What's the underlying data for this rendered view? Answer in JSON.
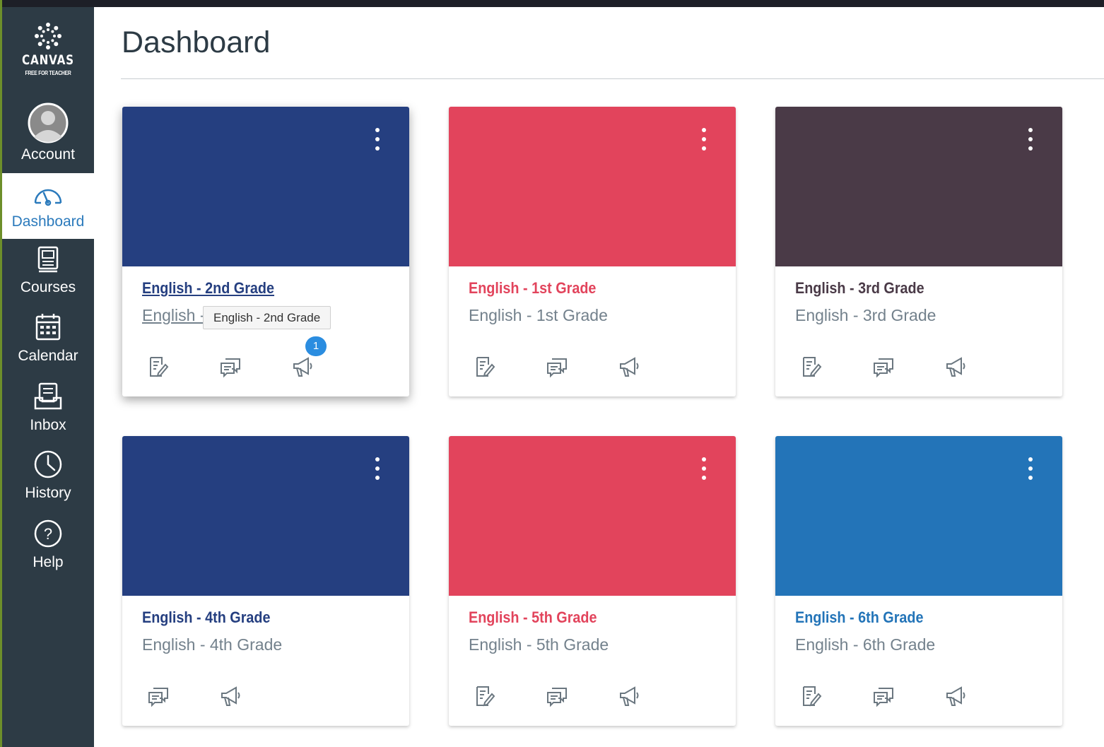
{
  "logo": {
    "brand": "CANVAS",
    "tagline": "FREE FOR TEACHER"
  },
  "nav": {
    "account": "Account",
    "dashboard": "Dashboard",
    "courses": "Courses",
    "calendar": "Calendar",
    "inbox": "Inbox",
    "history": "History",
    "help": "Help"
  },
  "page": {
    "title": "Dashboard"
  },
  "colors": {
    "sidebar": "#2d3b45",
    "active_nav_text": "#2b7abc",
    "navy": "#253f80",
    "red": "#e2445c",
    "plum": "#4a3a47",
    "blue": "#2374b8",
    "badge": "#2b8de0"
  },
  "cards": [
    {
      "name": "English - 2nd Grade",
      "subtitle": "English - 2nd Grade",
      "color": "#253f80",
      "tooltip": "English - 2nd Grade",
      "badge": "1",
      "actions": [
        "assignments-icon",
        "discussions-icon",
        "announcements-icon"
      ]
    },
    {
      "name": "English - 1st Grade",
      "subtitle": "English - 1st Grade",
      "color": "#e2445c",
      "actions": [
        "assignments-icon",
        "discussions-icon",
        "announcements-icon"
      ]
    },
    {
      "name": "English - 3rd Grade",
      "subtitle": "English - 3rd Grade",
      "color": "#4a3a47",
      "actions": [
        "assignments-icon",
        "discussions-icon",
        "announcements-icon"
      ]
    },
    {
      "name": "English - 4th Grade",
      "subtitle": "English - 4th Grade",
      "color": "#253f80",
      "actions": [
        "discussions-icon",
        "announcements-icon"
      ]
    },
    {
      "name": "English - 5th Grade",
      "subtitle": "English - 5th Grade",
      "color": "#e2445c",
      "actions": [
        "assignments-icon",
        "discussions-icon",
        "announcements-icon"
      ]
    },
    {
      "name": "English - 6th Grade",
      "subtitle": "English - 6th Grade",
      "color": "#2374b8",
      "actions": [
        "assignments-icon",
        "discussions-icon",
        "announcements-icon"
      ]
    }
  ]
}
